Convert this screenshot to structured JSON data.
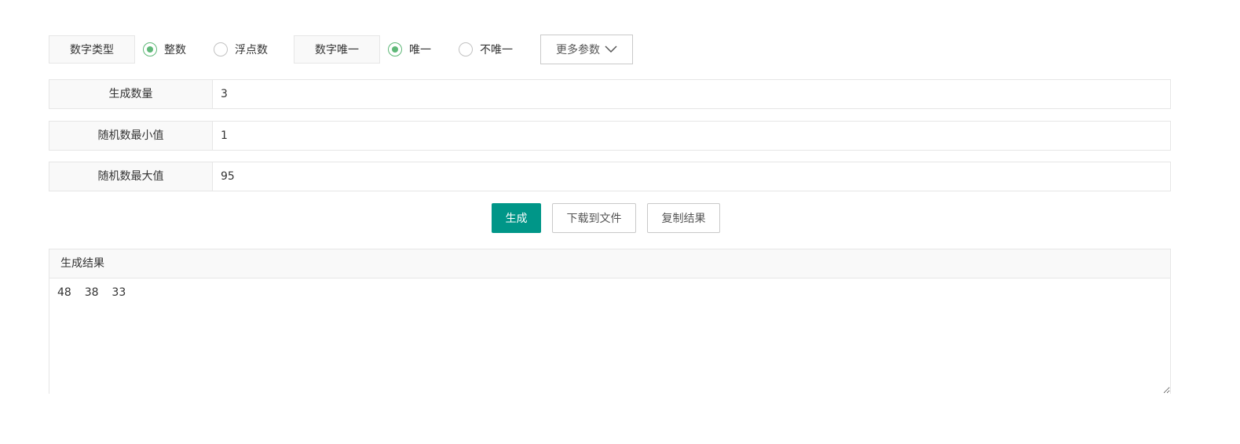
{
  "options": {
    "number_type_label": "数字类型",
    "integer_label": "整数",
    "float_label": "浮点数",
    "unique_label": "数字唯一",
    "unique_option_label": "唯一",
    "non_unique_option_label": "不唯一",
    "more_params_label": "更多参数",
    "selected_type": "整数",
    "selected_uniqueness": "唯一"
  },
  "params": {
    "count_label": "生成数量",
    "count_value": "3",
    "min_label": "随机数最小值",
    "min_value": "1",
    "max_label": "随机数最大值",
    "max_value": "95"
  },
  "actions": {
    "generate_label": "生成",
    "download_label": "下载到文件",
    "copy_label": "复制结果"
  },
  "result": {
    "title": "生成结果",
    "value": "48  38  33"
  },
  "colors": {
    "primary": "#009688",
    "radio_checked": "#5fb878"
  },
  "icons": {
    "more_params": "chevron-down-icon"
  }
}
